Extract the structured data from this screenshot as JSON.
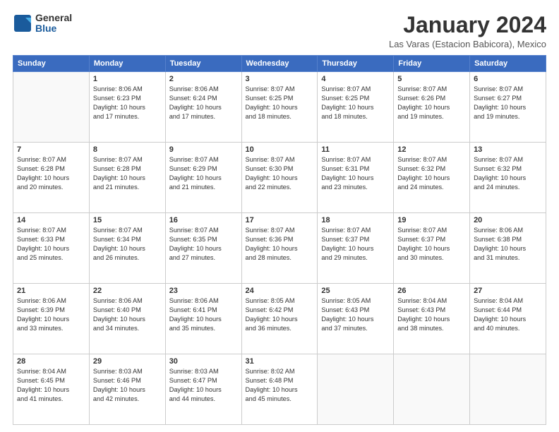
{
  "logo": {
    "line1": "General",
    "line2": "Blue"
  },
  "title": "January 2024",
  "subtitle": "Las Varas (Estacion Babicora), Mexico",
  "weekdays": [
    "Sunday",
    "Monday",
    "Tuesday",
    "Wednesday",
    "Thursday",
    "Friday",
    "Saturday"
  ],
  "weeks": [
    [
      {
        "day": "",
        "info": ""
      },
      {
        "day": "1",
        "info": "Sunrise: 8:06 AM\nSunset: 6:23 PM\nDaylight: 10 hours\nand 17 minutes."
      },
      {
        "day": "2",
        "info": "Sunrise: 8:06 AM\nSunset: 6:24 PM\nDaylight: 10 hours\nand 17 minutes."
      },
      {
        "day": "3",
        "info": "Sunrise: 8:07 AM\nSunset: 6:25 PM\nDaylight: 10 hours\nand 18 minutes."
      },
      {
        "day": "4",
        "info": "Sunrise: 8:07 AM\nSunset: 6:25 PM\nDaylight: 10 hours\nand 18 minutes."
      },
      {
        "day": "5",
        "info": "Sunrise: 8:07 AM\nSunset: 6:26 PM\nDaylight: 10 hours\nand 19 minutes."
      },
      {
        "day": "6",
        "info": "Sunrise: 8:07 AM\nSunset: 6:27 PM\nDaylight: 10 hours\nand 19 minutes."
      }
    ],
    [
      {
        "day": "7",
        "info": "Sunrise: 8:07 AM\nSunset: 6:28 PM\nDaylight: 10 hours\nand 20 minutes."
      },
      {
        "day": "8",
        "info": "Sunrise: 8:07 AM\nSunset: 6:28 PM\nDaylight: 10 hours\nand 21 minutes."
      },
      {
        "day": "9",
        "info": "Sunrise: 8:07 AM\nSunset: 6:29 PM\nDaylight: 10 hours\nand 21 minutes."
      },
      {
        "day": "10",
        "info": "Sunrise: 8:07 AM\nSunset: 6:30 PM\nDaylight: 10 hours\nand 22 minutes."
      },
      {
        "day": "11",
        "info": "Sunrise: 8:07 AM\nSunset: 6:31 PM\nDaylight: 10 hours\nand 23 minutes."
      },
      {
        "day": "12",
        "info": "Sunrise: 8:07 AM\nSunset: 6:32 PM\nDaylight: 10 hours\nand 24 minutes."
      },
      {
        "day": "13",
        "info": "Sunrise: 8:07 AM\nSunset: 6:32 PM\nDaylight: 10 hours\nand 24 minutes."
      }
    ],
    [
      {
        "day": "14",
        "info": "Sunrise: 8:07 AM\nSunset: 6:33 PM\nDaylight: 10 hours\nand 25 minutes."
      },
      {
        "day": "15",
        "info": "Sunrise: 8:07 AM\nSunset: 6:34 PM\nDaylight: 10 hours\nand 26 minutes."
      },
      {
        "day": "16",
        "info": "Sunrise: 8:07 AM\nSunset: 6:35 PM\nDaylight: 10 hours\nand 27 minutes."
      },
      {
        "day": "17",
        "info": "Sunrise: 8:07 AM\nSunset: 6:36 PM\nDaylight: 10 hours\nand 28 minutes."
      },
      {
        "day": "18",
        "info": "Sunrise: 8:07 AM\nSunset: 6:37 PM\nDaylight: 10 hours\nand 29 minutes."
      },
      {
        "day": "19",
        "info": "Sunrise: 8:07 AM\nSunset: 6:37 PM\nDaylight: 10 hours\nand 30 minutes."
      },
      {
        "day": "20",
        "info": "Sunrise: 8:06 AM\nSunset: 6:38 PM\nDaylight: 10 hours\nand 31 minutes."
      }
    ],
    [
      {
        "day": "21",
        "info": "Sunrise: 8:06 AM\nSunset: 6:39 PM\nDaylight: 10 hours\nand 33 minutes."
      },
      {
        "day": "22",
        "info": "Sunrise: 8:06 AM\nSunset: 6:40 PM\nDaylight: 10 hours\nand 34 minutes."
      },
      {
        "day": "23",
        "info": "Sunrise: 8:06 AM\nSunset: 6:41 PM\nDaylight: 10 hours\nand 35 minutes."
      },
      {
        "day": "24",
        "info": "Sunrise: 8:05 AM\nSunset: 6:42 PM\nDaylight: 10 hours\nand 36 minutes."
      },
      {
        "day": "25",
        "info": "Sunrise: 8:05 AM\nSunset: 6:43 PM\nDaylight: 10 hours\nand 37 minutes."
      },
      {
        "day": "26",
        "info": "Sunrise: 8:04 AM\nSunset: 6:43 PM\nDaylight: 10 hours\nand 38 minutes."
      },
      {
        "day": "27",
        "info": "Sunrise: 8:04 AM\nSunset: 6:44 PM\nDaylight: 10 hours\nand 40 minutes."
      }
    ],
    [
      {
        "day": "28",
        "info": "Sunrise: 8:04 AM\nSunset: 6:45 PM\nDaylight: 10 hours\nand 41 minutes."
      },
      {
        "day": "29",
        "info": "Sunrise: 8:03 AM\nSunset: 6:46 PM\nDaylight: 10 hours\nand 42 minutes."
      },
      {
        "day": "30",
        "info": "Sunrise: 8:03 AM\nSunset: 6:47 PM\nDaylight: 10 hours\nand 44 minutes."
      },
      {
        "day": "31",
        "info": "Sunrise: 8:02 AM\nSunset: 6:48 PM\nDaylight: 10 hours\nand 45 minutes."
      },
      {
        "day": "",
        "info": ""
      },
      {
        "day": "",
        "info": ""
      },
      {
        "day": "",
        "info": ""
      }
    ]
  ]
}
